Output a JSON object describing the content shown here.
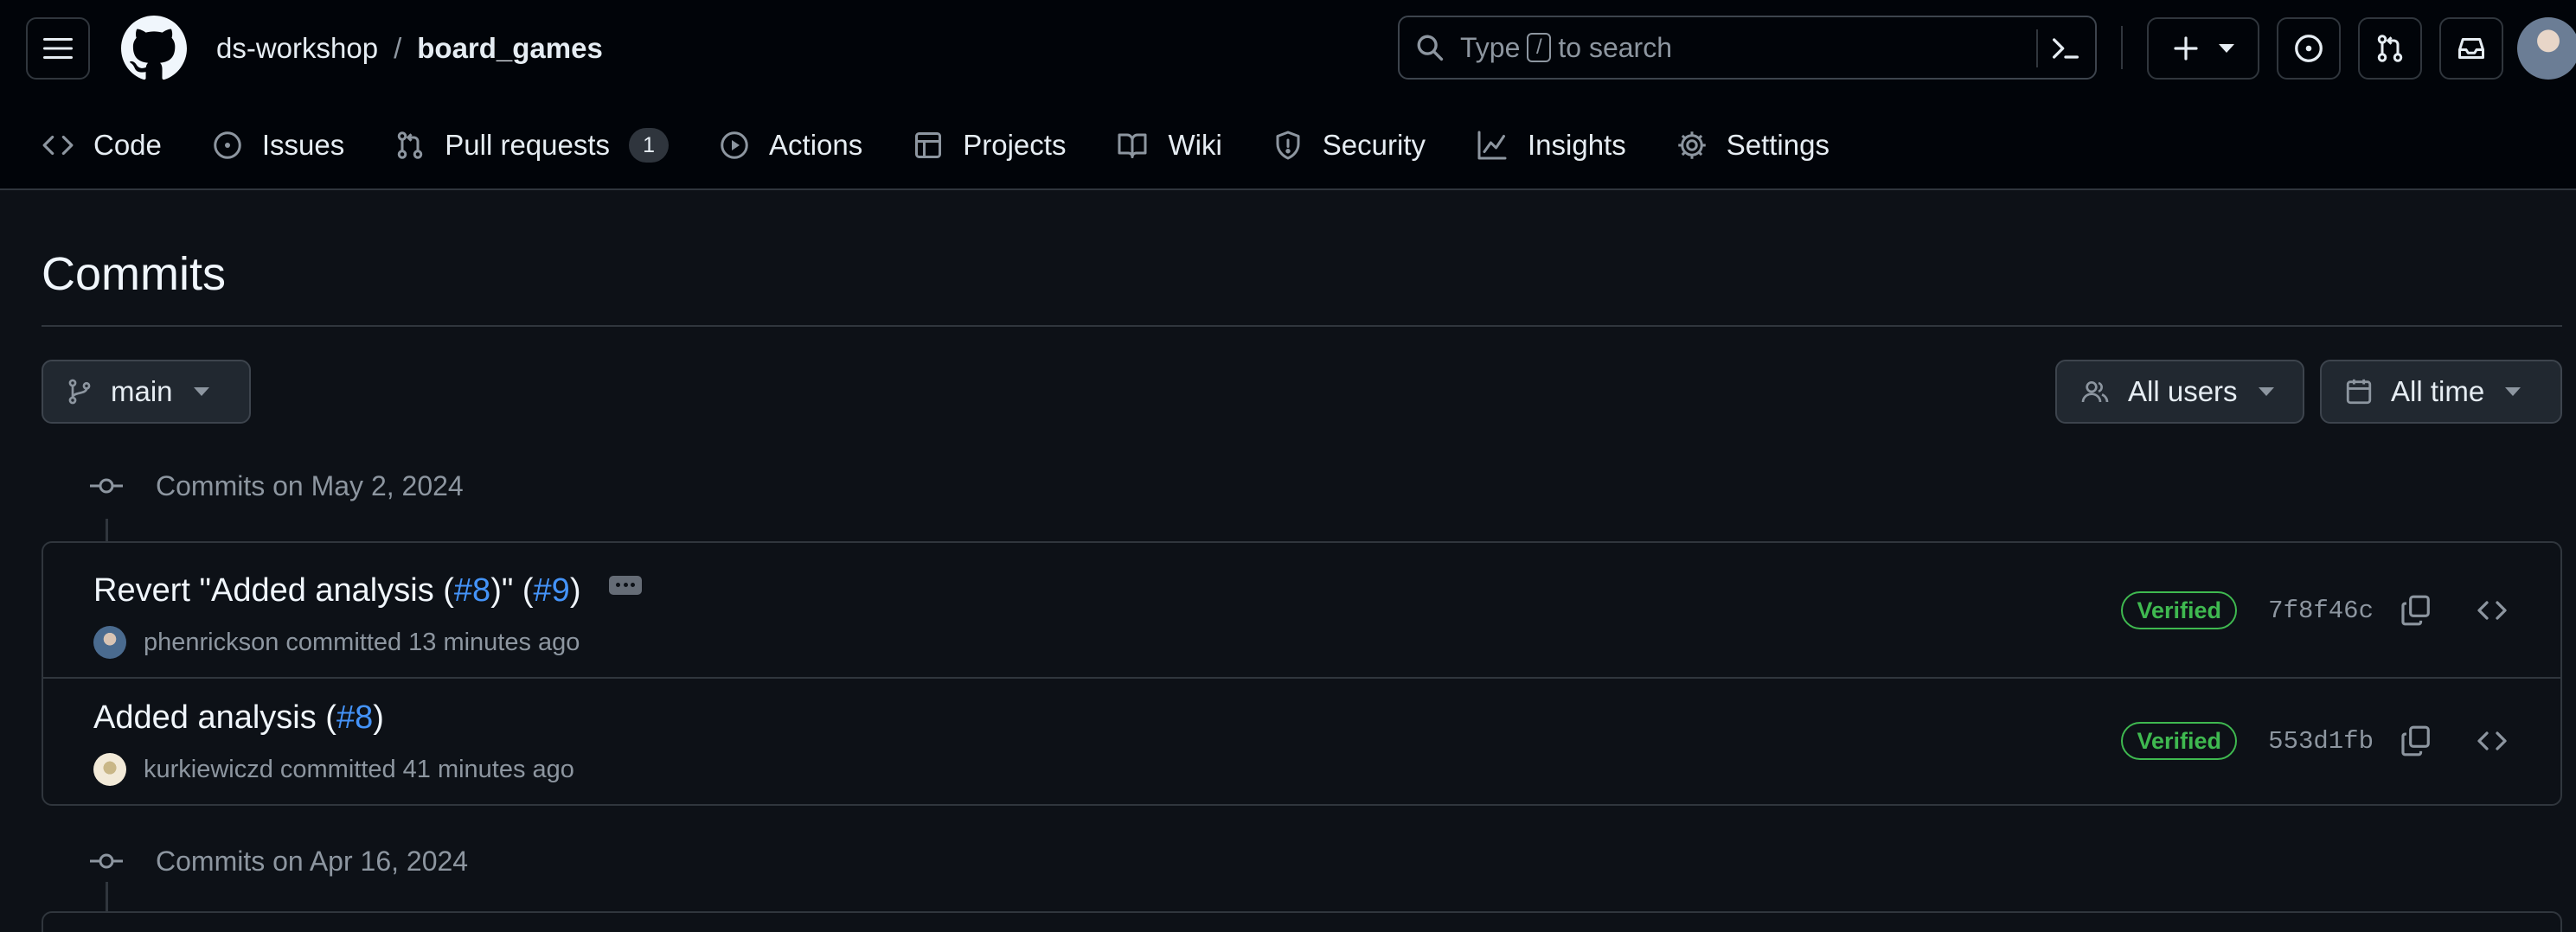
{
  "header": {
    "owner": "ds-workshop",
    "separator": "/",
    "repo": "board_games",
    "search": {
      "prefix": "Type",
      "key": "/",
      "suffix": "to search"
    }
  },
  "nav": {
    "tabs": [
      {
        "label": "Code",
        "icon": "code-icon"
      },
      {
        "label": "Issues",
        "icon": "issue-opened-icon"
      },
      {
        "label": "Pull requests",
        "icon": "git-pull-request-icon",
        "count": "1"
      },
      {
        "label": "Actions",
        "icon": "play-icon"
      },
      {
        "label": "Projects",
        "icon": "table-icon"
      },
      {
        "label": "Wiki",
        "icon": "book-icon"
      },
      {
        "label": "Security",
        "icon": "shield-icon"
      },
      {
        "label": "Insights",
        "icon": "graph-icon"
      },
      {
        "label": "Settings",
        "icon": "gear-icon"
      }
    ]
  },
  "main": {
    "title": "Commits",
    "branch_filter": "main",
    "users_filter": "All users",
    "time_filter": "All time",
    "groups": [
      {
        "heading": "Commits on May 2, 2024",
        "commits": [
          {
            "message_prefix": "Revert \"Added analysis (",
            "ref1": "#8",
            "message_middle": ")\" (",
            "ref2": "#9",
            "message_suffix": ")",
            "author": "phenrickson",
            "action": "committed",
            "time": "13 minutes ago",
            "badge": "Verified",
            "sha": "7f8f46c"
          },
          {
            "message_prefix": "Added analysis (",
            "ref1": "#8",
            "message_suffix": ")",
            "author": "kurkiewiczd",
            "action": "committed",
            "time": "41 minutes ago",
            "badge": "Verified",
            "sha": "553d1fb"
          }
        ]
      },
      {
        "heading": "Commits on Apr 16, 2024"
      }
    ]
  },
  "colors": {
    "background": "#0d1117",
    "header_bg": "#010409",
    "border": "#30363d",
    "link": "#4493f8",
    "verified": "#3fb950",
    "muted": "#8d96a0"
  }
}
